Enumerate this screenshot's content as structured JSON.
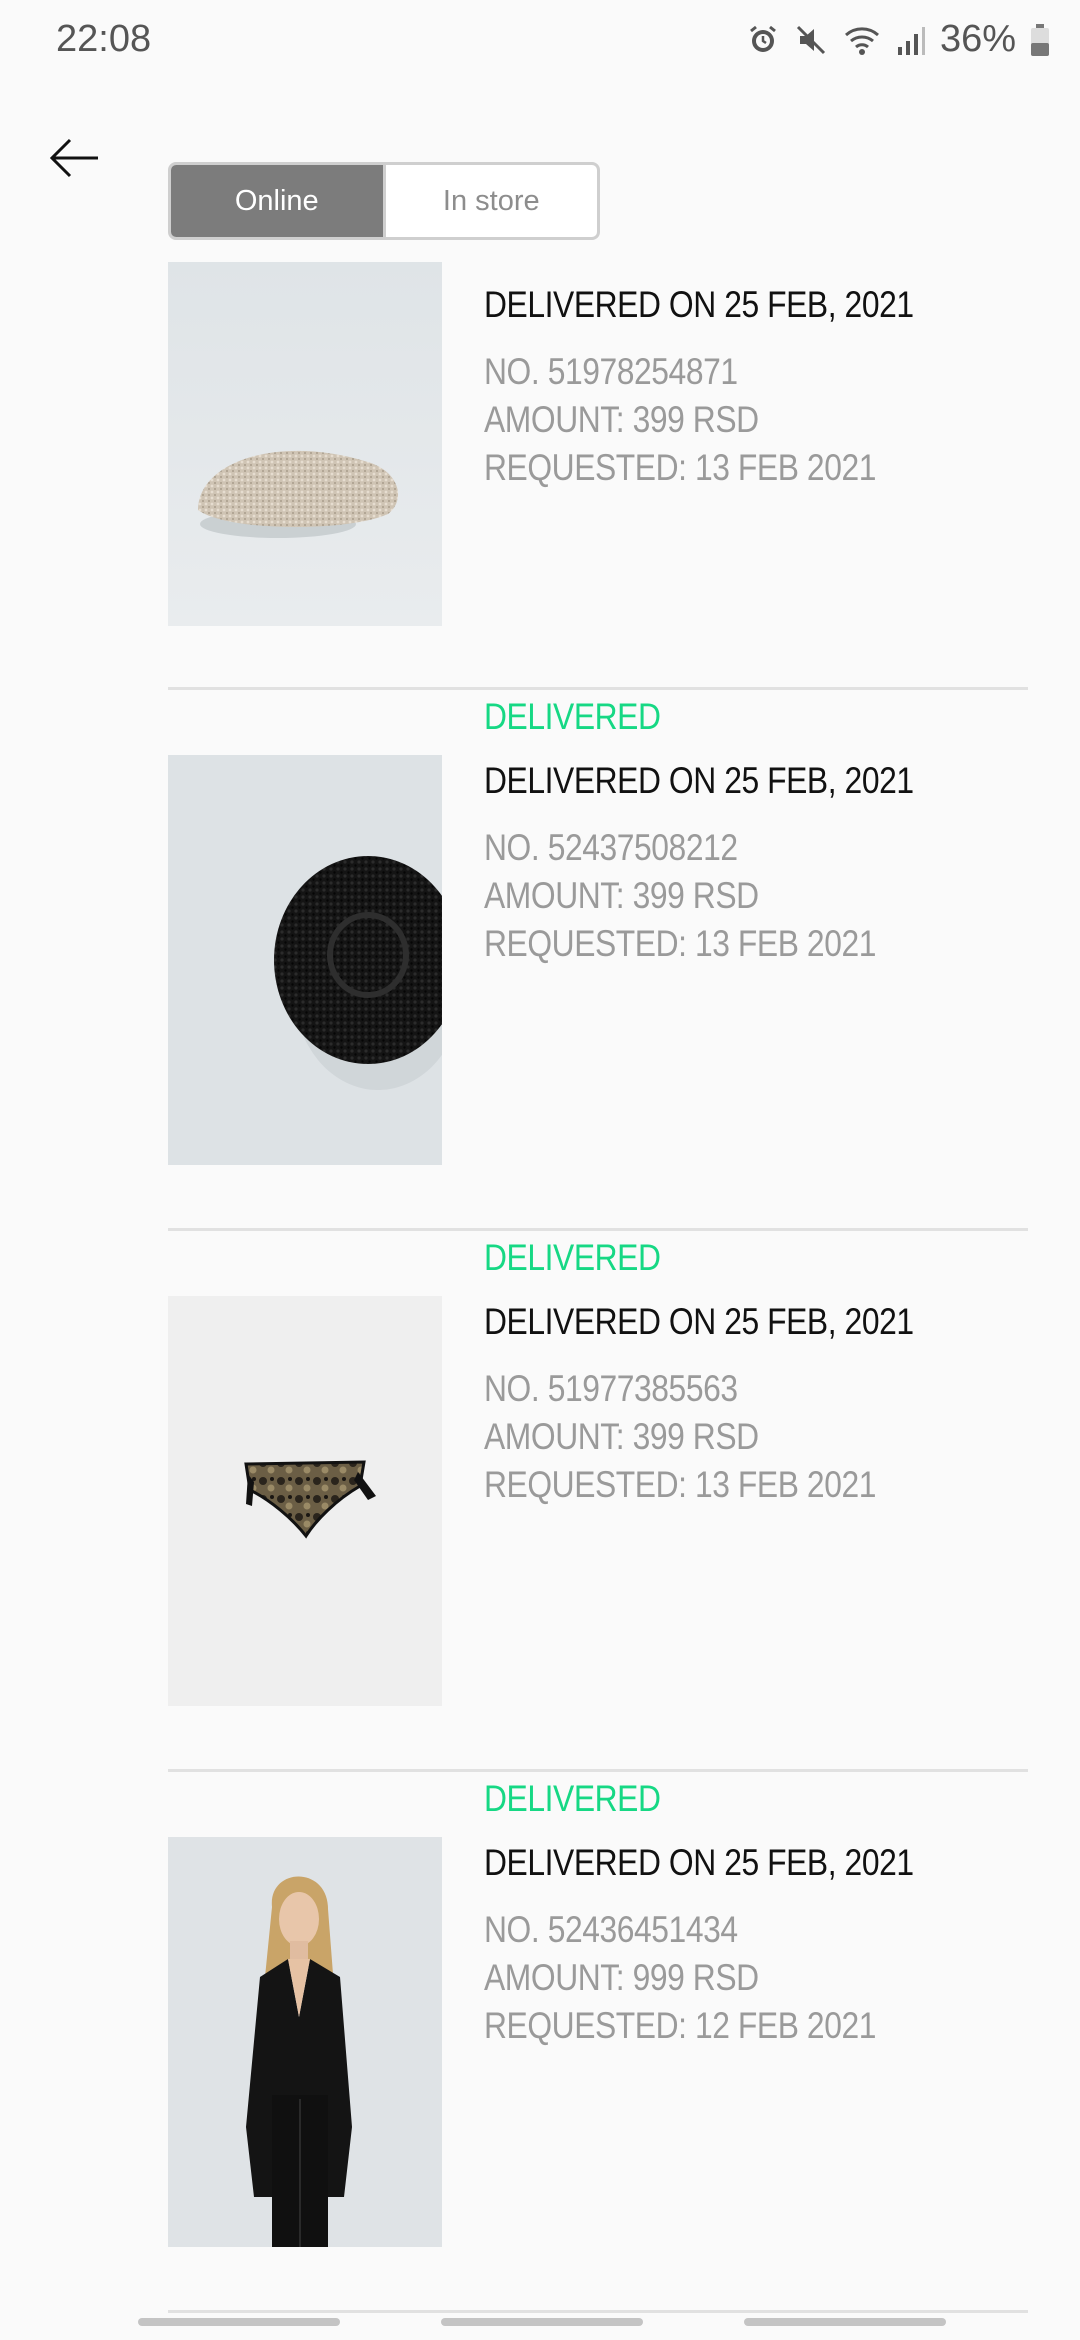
{
  "status_bar": {
    "time": "22:08",
    "battery": "36%",
    "icons": [
      "alarm-icon",
      "mute-icon",
      "wifi-icon",
      "signal-icon",
      "battery-icon"
    ]
  },
  "tabs": [
    {
      "label": "Online",
      "active": true
    },
    {
      "label": "In store",
      "active": false
    }
  ],
  "colors": {
    "accent_delivered": "#16d884",
    "tab_active": "#7c7c7c"
  },
  "orders": [
    {
      "status": "",
      "headline": "DELIVERED ON 25 FEB, 2021",
      "number": "NO. 51978254871",
      "amount": "AMOUNT: 399 RSD",
      "requested": "REQUESTED: 13 FEB 2021",
      "image": "beige-beret"
    },
    {
      "status": "DELIVERED",
      "headline": "DELIVERED ON 25 FEB, 2021",
      "number": "NO. 52437508212",
      "amount": "AMOUNT: 399 RSD",
      "requested": "REQUESTED: 13 FEB 2021",
      "image": "black-beret"
    },
    {
      "status": "DELIVERED",
      "headline": "DELIVERED ON 25 FEB, 2021",
      "number": "NO. 51977385563",
      "amount": "AMOUNT: 399 RSD",
      "requested": "REQUESTED: 13 FEB 2021",
      "image": "camo-bikini-bottom"
    },
    {
      "status": "DELIVERED",
      "headline": "DELIVERED ON 25 FEB, 2021",
      "number": "NO. 52436451434",
      "amount": "AMOUNT: 999 RSD",
      "requested": "REQUESTED: 12 FEB 2021",
      "image": "black-suit-model"
    }
  ]
}
